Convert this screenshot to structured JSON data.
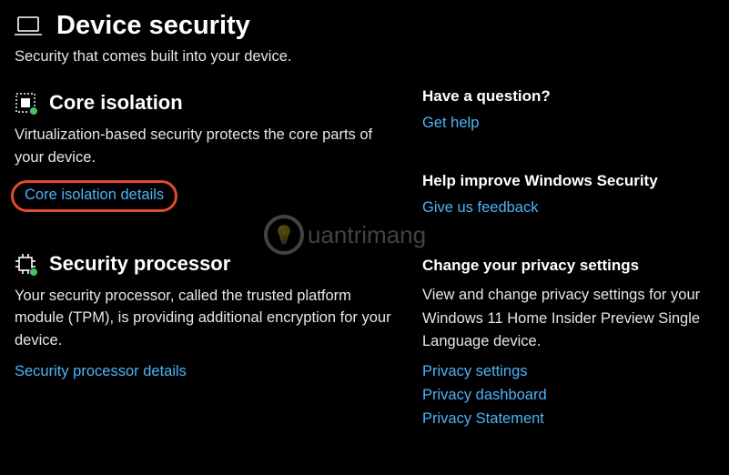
{
  "header": {
    "title": "Device security",
    "subtitle": "Security that comes built into your device."
  },
  "sections": {
    "coreIsolation": {
      "title": "Core isolation",
      "desc": "Virtualization-based security protects the core parts of your device.",
      "link": "Core isolation details"
    },
    "securityProcessor": {
      "title": "Security processor",
      "desc": "Your security processor, called the trusted platform module (TPM), is providing additional encryption for your device.",
      "link": "Security processor details"
    }
  },
  "sidebar": {
    "question": {
      "heading": "Have a question?",
      "link": "Get help"
    },
    "feedback": {
      "heading": "Help improve Windows Security",
      "link": "Give us feedback"
    },
    "privacy": {
      "heading": "Change your privacy settings",
      "desc": "View and change privacy settings for your Windows 11 Home Insider Preview Single Language device.",
      "links": {
        "settings": "Privacy settings",
        "dashboard": "Privacy dashboard",
        "statement": "Privacy Statement"
      }
    }
  },
  "watermark": "uantrimang"
}
